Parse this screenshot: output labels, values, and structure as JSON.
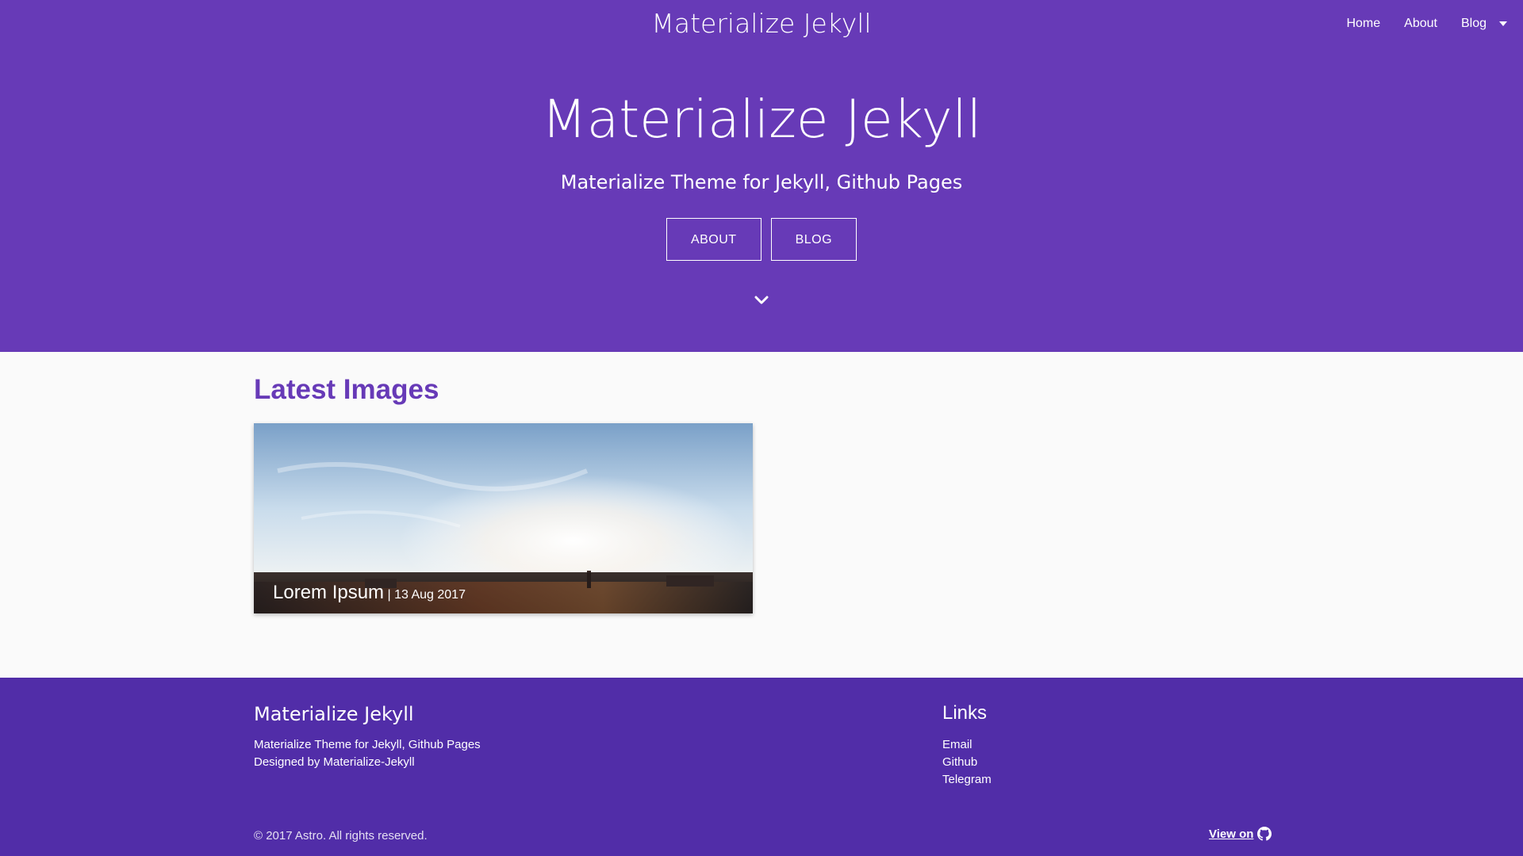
{
  "nav": {
    "brand": "Materialize Jekyll",
    "items": [
      {
        "label": "Home"
      },
      {
        "label": "About"
      },
      {
        "label": "Blog"
      }
    ]
  },
  "hero": {
    "title": "Materialize Jekyll",
    "subtitle": "Materialize Theme for Jekyll, Github Pages",
    "buttons": [
      {
        "label": "ABOUT"
      },
      {
        "label": "BLOG"
      }
    ]
  },
  "main": {
    "section_title": "Latest Images",
    "cards": [
      {
        "title": "Lorem Ipsum",
        "date_sep": " | ",
        "date": "13 Aug 2017"
      }
    ]
  },
  "footer": {
    "title": "Materialize Jekyll",
    "lines": [
      "Materialize Theme for Jekyll, Github Pages",
      "Designed by Materialize-Jekyll"
    ],
    "links_title": "Links",
    "links": [
      {
        "label": "Email"
      },
      {
        "label": "Github"
      },
      {
        "label": "Telegram"
      }
    ],
    "copyright": "© 2017 Astro. All rights reserved.",
    "view_on": "View on"
  },
  "colors": {
    "primary": "#673ab7",
    "footer": "#512da8",
    "background": "#fafafa"
  },
  "icons": [
    "chevron-down-icon",
    "github-icon",
    "caret-down-icon"
  ]
}
